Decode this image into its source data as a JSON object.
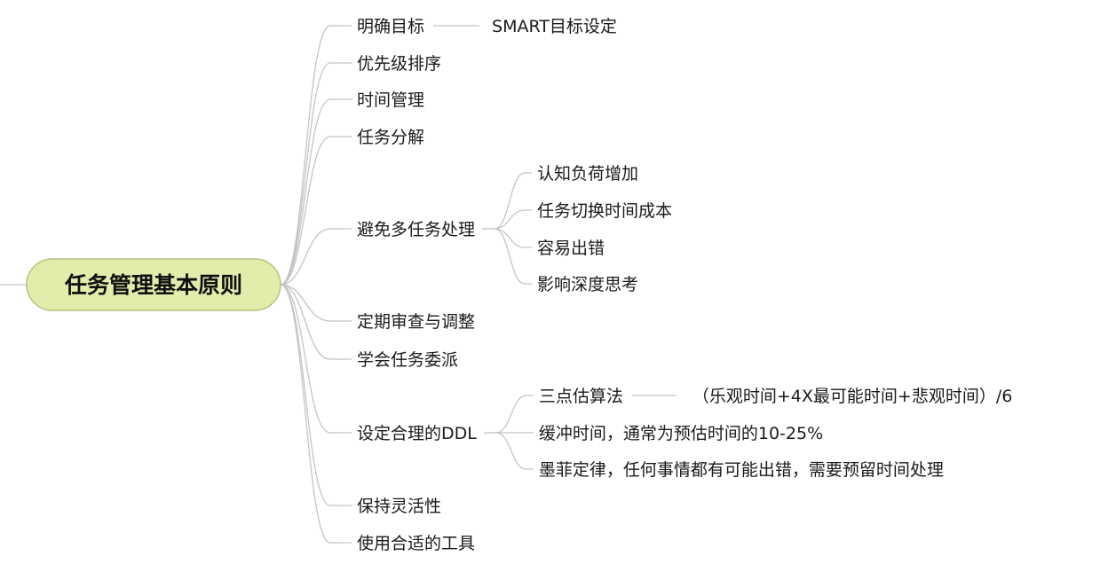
{
  "root": {
    "label": "任务管理基本原则"
  },
  "colors": {
    "root_fill": "#e4ecab",
    "root_stroke": "#b6c080",
    "line": "#c4c4c4",
    "text": "#1a1a1a"
  },
  "branches": [
    {
      "label": "明确目标",
      "children": [
        {
          "label": "SMART目标设定"
        }
      ]
    },
    {
      "label": "优先级排序",
      "children": []
    },
    {
      "label": "时间管理",
      "children": []
    },
    {
      "label": "任务分解",
      "children": []
    },
    {
      "label": "避免多任务处理",
      "children": [
        {
          "label": "认知负荷增加"
        },
        {
          "label": "任务切换时间成本"
        },
        {
          "label": "容易出错"
        },
        {
          "label": "影响深度思考"
        }
      ]
    },
    {
      "label": "定期审查与调整",
      "children": []
    },
    {
      "label": "学会任务委派",
      "children": []
    },
    {
      "label": "设定合理的DDL",
      "children": [
        {
          "label": "三点估算法",
          "children": [
            {
              "label": "（乐观时间+4X最可能时间+悲观时间）/6"
            }
          ]
        },
        {
          "label": "缓冲时间，通常为预估时间的10-25%"
        },
        {
          "label": "墨菲定律，任何事情都有可能出错，需要预留时间处理"
        }
      ]
    },
    {
      "label": "保持灵活性",
      "children": []
    },
    {
      "label": "使用合适的工具",
      "children": []
    }
  ]
}
